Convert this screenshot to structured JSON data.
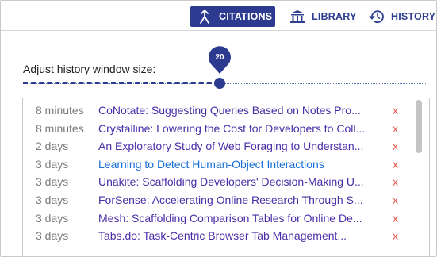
{
  "tabs": [
    {
      "label": "CITATIONS",
      "icon": "merge-arrow-icon",
      "active": true
    },
    {
      "label": "LIBRARY",
      "icon": "library-icon",
      "active": false
    },
    {
      "label": "HISTORY",
      "icon": "history-icon",
      "active": false
    }
  ],
  "window_control": {
    "label": "Adjust history window size:",
    "value": "20",
    "slider_fraction": 0.48
  },
  "history": [
    {
      "time": "8 minutes",
      "title": "CoNotate: Suggesting Queries Based on Notes Pro...",
      "remove": "x"
    },
    {
      "time": "8 minutes",
      "title": "Crystalline: Lowering the Cost for Developers to Coll...",
      "remove": "x"
    },
    {
      "time": "2 days",
      "title": "An Exploratory Study of Web Foraging to Understan...",
      "remove": "x"
    },
    {
      "time": "3 days",
      "title": "Learning to Detect Human-Object Interactions",
      "remove": "x"
    },
    {
      "time": "3 days",
      "title": "Unakite: Scaffolding Developers' Decision-Making U...",
      "remove": "x"
    },
    {
      "time": "3 days",
      "title": "ForSense: Accelerating Online Research Through S...",
      "remove": "x"
    },
    {
      "time": "3 days",
      "title": "Mesh: Scaffolding Comparison Tables for Online De...",
      "remove": "x"
    },
    {
      "time": "3 days",
      "title": "Tabs.do: Task-Centric Browser Tab Management...",
      "remove": "x"
    }
  ],
  "colors": {
    "accent": "#2c3a8f",
    "link": "#4a2ea8",
    "visited_link": "#1a6fd6",
    "remove": "#e8574a"
  }
}
